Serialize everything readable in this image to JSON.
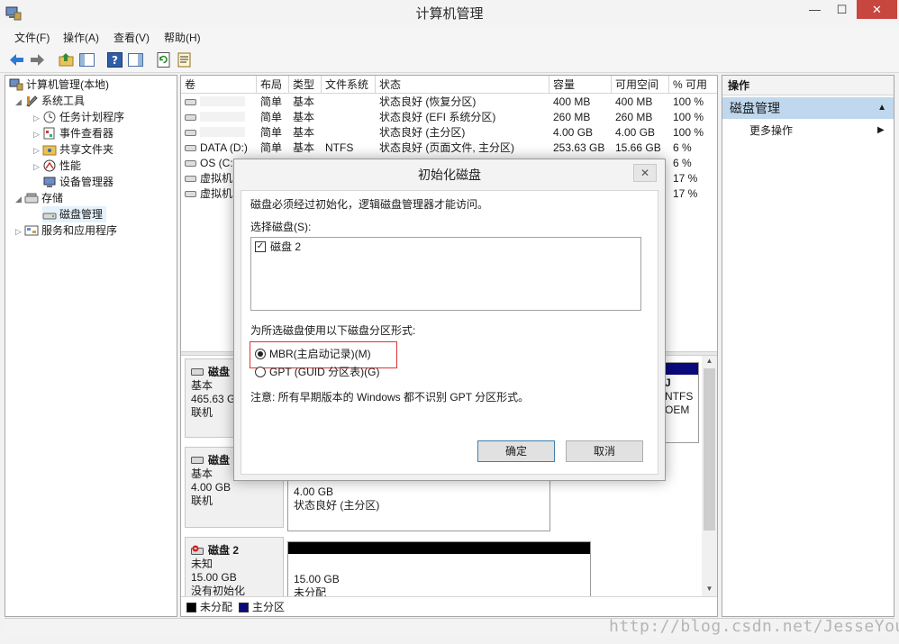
{
  "window": {
    "title": "计算机管理",
    "minimize": "—",
    "maximize": "☐",
    "close": "✕"
  },
  "menu": [
    "文件(F)",
    "操作(A)",
    "查看(V)",
    "帮助(H)"
  ],
  "tree": {
    "root": "计算机管理(本地)",
    "system_tools": "系统工具",
    "task_scheduler": "任务计划程序",
    "event_viewer": "事件查看器",
    "shared_folders": "共享文件夹",
    "performance": "性能",
    "device_manager": "设备管理器",
    "storage": "存储",
    "disk_management": "磁盘管理",
    "services_apps": "服务和应用程序"
  },
  "volumes": {
    "headers": [
      "卷",
      "布局",
      "类型",
      "文件系统",
      "状态",
      "容量",
      "可用空间",
      "% 可用"
    ],
    "rows": [
      {
        "vol": "",
        "layout": "简单",
        "type": "基本",
        "fs": "",
        "status": "状态良好 (恢复分区)",
        "cap": "400 MB",
        "free": "400 MB",
        "pct": "100 %"
      },
      {
        "vol": "",
        "layout": "简单",
        "type": "基本",
        "fs": "",
        "status": "状态良好 (EFI 系统分区)",
        "cap": "260 MB",
        "free": "260 MB",
        "pct": "100 %"
      },
      {
        "vol": "",
        "layout": "简单",
        "type": "基本",
        "fs": "",
        "status": "状态良好 (主分区)",
        "cap": "4.00 GB",
        "free": "4.00 GB",
        "pct": "100 %"
      },
      {
        "vol": "DATA (D:)",
        "layout": "简单",
        "type": "基本",
        "fs": "NTFS",
        "status": "状态良好 (页面文件, 主分区)",
        "cap": "253.63 GB",
        "free": "15.66 GB",
        "pct": "6 %"
      },
      {
        "vol": "OS (C:",
        "layout": "",
        "type": "",
        "fs": "",
        "status": "",
        "cap": "",
        "free": "",
        "pct": "6 %"
      },
      {
        "vol": "虚拟机",
        "layout": "",
        "type": "",
        "fs": "",
        "status": "",
        "cap": "",
        "free": "",
        "pct": "17 %"
      },
      {
        "vol": "虚拟机",
        "layout": "",
        "type": "",
        "fs": "",
        "status": "",
        "cap": "",
        "free": "",
        "pct": "17 %"
      }
    ]
  },
  "disks": [
    {
      "name": "磁盘",
      "type": "基本",
      "size": "465.63 G",
      "state": "联机",
      "part_frag1": "J",
      "part_frag2": "NTFS",
      "part_frag3": "OEM"
    },
    {
      "name": "磁盘",
      "type": "基本",
      "size": "4.00 GB",
      "state": "联机",
      "part_size": "4.00 GB",
      "part_status": "状态良好 (主分区)"
    },
    {
      "name": "磁盘 2",
      "type": "未知",
      "size": "15.00 GB",
      "state": "没有初始化",
      "part_size": "15.00 GB",
      "part_status": "未分配"
    }
  ],
  "legend": [
    "未分配",
    "主分区"
  ],
  "actions": {
    "header": "操作",
    "section": "磁盘管理",
    "more": "更多操作"
  },
  "dialog": {
    "title": "初始化磁盘",
    "close": "✕",
    "intro": "磁盘必须经过初始化，逻辑磁盘管理器才能访问。",
    "select_label": "选择磁盘(S):",
    "disk_item": "磁盘 2",
    "partition_label": "为所选磁盘使用以下磁盘分区形式:",
    "mbr_option": "MBR(主启动记录)(M)",
    "gpt_option": "GPT (GUID 分区表)(G)",
    "note": "注意: 所有早期版本的 Windows 都不识别 GPT 分区形式。",
    "ok": "确定",
    "cancel": "取消"
  },
  "watermark": "http://blog.csdn.net/JesseYoung",
  "colors": {
    "primary_partition": "#0a0a7a",
    "unallocated": "#000000",
    "close_button": "#c7463e",
    "highlight_box": "#dd3333",
    "action_section": "#bfd8ee"
  }
}
